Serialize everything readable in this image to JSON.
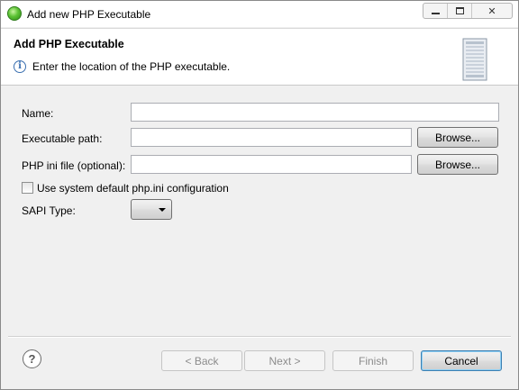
{
  "window": {
    "title": "Add new PHP Executable",
    "minimize_icon": "minimize-icon",
    "maximize_icon": "maximize-icon",
    "close_label": "✕"
  },
  "banner": {
    "title": "Add PHP Executable",
    "message": "Enter the location of the PHP executable.",
    "info_icon": "i",
    "server_icon": "server-icon"
  },
  "form": {
    "name_label": "Name:",
    "name_value": "",
    "exec_label": "Executable path:",
    "exec_value": "",
    "exec_browse": "Browse...",
    "ini_label": "PHP ini file (optional):",
    "ini_value": "",
    "ini_browse": "Browse...",
    "use_default_label": "Use system default php.ini configuration",
    "use_default_checked": false,
    "sapi_label": "SAPI Type:",
    "sapi_value": ""
  },
  "footer": {
    "help_icon": "?",
    "back": "< Back",
    "next": "Next >",
    "finish": "Finish",
    "cancel": "Cancel"
  },
  "colors": {
    "info_blue": "#3a6fb0",
    "app_green": "#5cc234"
  }
}
